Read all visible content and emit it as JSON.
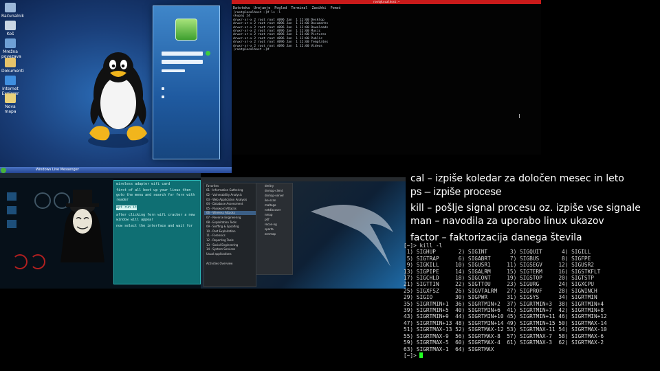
{
  "slide": {
    "lines": [
      "cal – izpiše koledar za določen mesec in leto",
      "ps – izpiše procese",
      "kill – pošlje signal procesu oz. izpiše vse signale",
      "man – navodila za uporabo linux ukazov",
      "factor – faktorizacija danega števila"
    ]
  },
  "windows_desktop": {
    "icons": [
      "Računalnik",
      "Koš",
      "Mrežna povezava",
      "Dokumenti",
      "Internet Explorer",
      "Nova mapa"
    ],
    "taskbar_item": "Windows Live Messenger"
  },
  "terminal_top": {
    "title": "root@localhost:~",
    "menu": [
      "Datoteka",
      "Urejanje",
      "Pogled",
      "Terminal",
      "Zavihki",
      "Pomoč"
    ],
    "lines": [
      "[root@localhost ~]# ls -l",
      "skupaj 24",
      "drwxr-xr-x 2 root root 4096 Jan  1 12:00 Desktop",
      "drwxr-xr-x 2 root root 4096 Jan  1 12:00 Documents",
      "drwxr-xr-x 2 root root 4096 Jan  1 12:00 Downloads",
      "drwxr-xr-x 2 root root 4096 Jan  1 12:00 Music",
      "drwxr-xr-x 2 root root 4096 Jan  1 12:00 Pictures",
      "drwxr-xr-x 2 root root 4096 Jan  1 12:00 Public",
      "drwxr-xr-x 2 root root 4096 Jan  1 12:00 Templates",
      "drwxr-xr-x 2 root root 4096 Jan  1 12:00 Videos",
      "[root@localhost ~]# "
    ]
  },
  "hacker_notes": {
    "lines": [
      "wireless adapter wifi card",
      "first of all boot up your linux then goto the menu and search for fern with reader",
      "apt run it",
      "after clicking fern wifi cracker a new window will appear",
      "now select the interface and wait for"
    ]
  },
  "kali_menu": {
    "items": [
      "Favorites",
      "01 - Information Gathering",
      "02 - Vulnerability Analysis",
      "03 - Web Application Analysis",
      "04 - Database Assessment",
      "05 - Password Attacks",
      "06 - Wireless Attacks",
      "07 - Reverse Engineering",
      "08 - Exploitation Tools",
      "09 - Sniffing & Spoofing",
      "10 - Post Exploitation",
      "11 - Forensics",
      "12 - Reporting Tools",
      "13 - Social Engineering",
      "14 - System Services",
      "Usual applications"
    ],
    "footer": "Activities Overview",
    "sub_items": [
      "dmitry",
      "dnmap-client",
      "dnmap-server",
      "ike-scan",
      "maltego",
      "netdiscover",
      "nmap",
      "p0f",
      "recon-ng",
      "sparta",
      "zenmap"
    ]
  },
  "signal_terminal": {
    "prompt": "[~]>",
    "command": "kill -l",
    "signals": [
      [
        1,
        "SIGHUP"
      ],
      [
        2,
        "SIGINT"
      ],
      [
        3,
        "SIGQUIT"
      ],
      [
        4,
        "SIGILL"
      ],
      [
        5,
        "SIGTRAP"
      ],
      [
        6,
        "SIGABRT"
      ],
      [
        7,
        "SIGBUS"
      ],
      [
        8,
        "SIGFPE"
      ],
      [
        9,
        "SIGKILL"
      ],
      [
        10,
        "SIGUSR1"
      ],
      [
        11,
        "SIGSEGV"
      ],
      [
        12,
        "SIGUSR2"
      ],
      [
        13,
        "SIGPIPE"
      ],
      [
        14,
        "SIGALRM"
      ],
      [
        15,
        "SIGTERM"
      ],
      [
        16,
        "SIGSTKFLT"
      ],
      [
        17,
        "SIGCHLD"
      ],
      [
        18,
        "SIGCONT"
      ],
      [
        19,
        "SIGSTOP"
      ],
      [
        20,
        "SIGTSTP"
      ],
      [
        21,
        "SIGTTIN"
      ],
      [
        22,
        "SIGTTOU"
      ],
      [
        23,
        "SIGURG"
      ],
      [
        24,
        "SIGXCPU"
      ],
      [
        25,
        "SIGXFSZ"
      ],
      [
        26,
        "SIGVTALRM"
      ],
      [
        27,
        "SIGPROF"
      ],
      [
        28,
        "SIGWINCH"
      ],
      [
        29,
        "SIGIO"
      ],
      [
        30,
        "SIGPWR"
      ],
      [
        31,
        "SIGSYS"
      ],
      [
        34,
        "SIGRTMIN"
      ],
      [
        35,
        "SIGRTMIN+1"
      ],
      [
        36,
        "SIGRTMIN+2"
      ],
      [
        37,
        "SIGRTMIN+3"
      ],
      [
        38,
        "SIGRTMIN+4"
      ],
      [
        39,
        "SIGRTMIN+5"
      ],
      [
        40,
        "SIGRTMIN+6"
      ],
      [
        41,
        "SIGRTMIN+7"
      ],
      [
        42,
        "SIGRTMIN+8"
      ],
      [
        43,
        "SIGRTMIN+9"
      ],
      [
        44,
        "SIGRTMIN+10"
      ],
      [
        45,
        "SIGRTMIN+11"
      ],
      [
        46,
        "SIGRTMIN+12"
      ],
      [
        47,
        "SIGRTMIN+13"
      ],
      [
        48,
        "SIGRTMIN+14"
      ],
      [
        49,
        "SIGRTMIN+15"
      ],
      [
        50,
        "SIGRTMAX-14"
      ],
      [
        51,
        "SIGRTMAX-13"
      ],
      [
        52,
        "SIGRTMAX-12"
      ],
      [
        53,
        "SIGRTMAX-11"
      ],
      [
        54,
        "SIGRTMAX-10"
      ],
      [
        55,
        "SIGRTMAX-9"
      ],
      [
        56,
        "SIGRTMAX-8"
      ],
      [
        57,
        "SIGRTMAX-7"
      ],
      [
        58,
        "SIGRTMAX-6"
      ],
      [
        59,
        "SIGRTMAX-5"
      ],
      [
        60,
        "SIGRTMAX-4"
      ],
      [
        61,
        "SIGRTMAX-3"
      ],
      [
        62,
        "SIGRTMAX-2"
      ],
      [
        63,
        "SIGRTMAX-1"
      ],
      [
        64,
        "SIGRTMAX"
      ]
    ]
  },
  "colors": {
    "cursor": "#22ff22",
    "terminal_title_bar": "#c91a1a",
    "login_panel": "#2f73bb"
  }
}
